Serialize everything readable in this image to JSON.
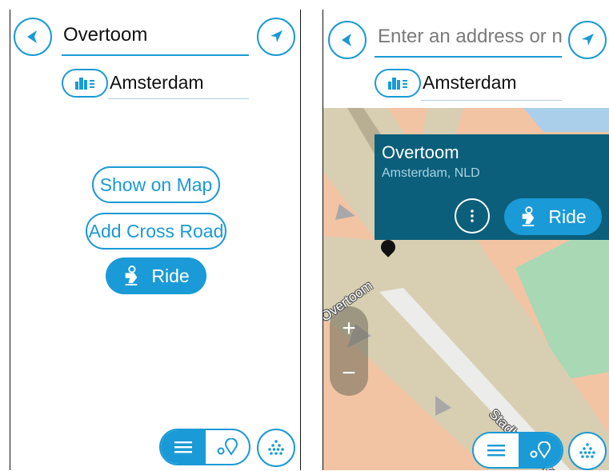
{
  "left_screen": {
    "search": {
      "value": "Overtoom"
    },
    "city": {
      "value": "Amsterdam",
      "icon": "city-icon"
    },
    "actions": {
      "show_on_map": "Show on Map",
      "add_cross_road": "Add Cross Road",
      "ride": "Ride"
    },
    "icons": {
      "back": "back-arrow-icon",
      "location": "current-location-icon",
      "ride": "scooter-icon"
    },
    "view_toggle": {
      "selected": "list",
      "options": [
        "list",
        "map"
      ]
    }
  },
  "right_screen": {
    "search": {
      "placeholder": "Enter an address or name"
    },
    "city": {
      "value": "Amsterdam",
      "icon": "city-icon"
    },
    "popup": {
      "title": "Overtoom",
      "subtitle": "Amsterdam, NLD",
      "ride": "Ride"
    },
    "zoom": {
      "in": "+",
      "out": "−"
    },
    "map_labels": {
      "overtoom": "Overtoom",
      "stadhouderskade": "Stadhouderskade"
    },
    "view_toggle": {
      "selected": "list",
      "options": [
        "list",
        "map"
      ]
    }
  },
  "colors": {
    "accent": "#1a9ad6",
    "popup_background": "#0b5f7a",
    "popup_subtitle": "#a9d4e4",
    "map_land": "#f2c4a3",
    "map_road": "#d8cfb3",
    "map_park": "#a9d8b4",
    "map_water": "#a9cfea"
  }
}
